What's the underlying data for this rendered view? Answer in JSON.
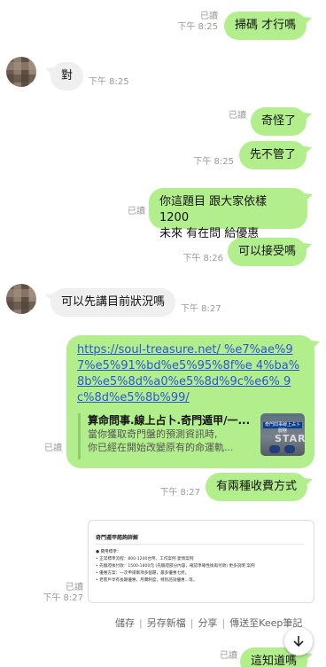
{
  "messages": {
    "m1": {
      "text": "掃碼 才行嗎",
      "read": "已讀",
      "time": "下午 8:25"
    },
    "m2": {
      "text": "對",
      "time": "下午 8:25"
    },
    "m3": {
      "text": "奇怪了",
      "read": "已讀"
    },
    "m4": {
      "text": "先不管了",
      "time": "下午 8:25"
    },
    "m5": {
      "line1": "你這題目 跟大家依樣 1200",
      "line2": "未來 有在問 給優惠",
      "read": "已讀"
    },
    "m6": {
      "text": "可以接受嗎",
      "time": "下午 8:26"
    },
    "m7": {
      "text": "可以先講目前狀況嗎",
      "time": "下午 8:27"
    },
    "m8": {
      "url_lines": [
        "https://soul-treasure.net/",
        "%e7%ae%97%e5%91%bd%e5%95%8f%e",
        "4%ba%8b%e5%8d%a0%e5%8d%9c%e6%",
        "9c%8d%e5%8b%99/"
      ],
      "preview_title": "算命問事.線上占卜.奇門遁甲/一...",
      "preview_desc1": "當你獲取奇門盤的預測資訊時,",
      "preview_desc2": "你已經在開始改變原有的命運軌...",
      "thumb_banner": "奇門問事線上占卜服務",
      "thumb_text": "START",
      "read": "已讀"
    },
    "m9": {
      "text": "有兩種收費方式",
      "time": "下午 8:27"
    },
    "m10": {
      "read": "已讀",
      "time": "下午 8:27",
      "doc_title": "奇門遁甲諮詢詳解",
      "doc_lines": [
        "● 費用標準：",
        "  • 正常標準流程：800-1200台幣，工作案例 愛情案例",
        "  • 先驗證後付款：1500-1800元 (先驗證部分內容，確認準確性後再付款) 更多說明 案例",
        "  • 優惠方案：一次申請兩項多個題，最多優惠七折。",
        "  • 老客戶享有長期優惠，月費制度，特別諮詢優惠…等。"
      ]
    },
    "m11": {
      "text": "這知道嗎",
      "read": "已讀"
    }
  },
  "actions": [
    "儲存",
    "另存新檔",
    "分享",
    "傳送至Keep筆記"
  ],
  "icons": {
    "scroll": "arrow-down-icon"
  },
  "colors": {
    "outgoing": "#b3ee8d",
    "incoming": "#efefef",
    "link": "#2b57d6"
  }
}
